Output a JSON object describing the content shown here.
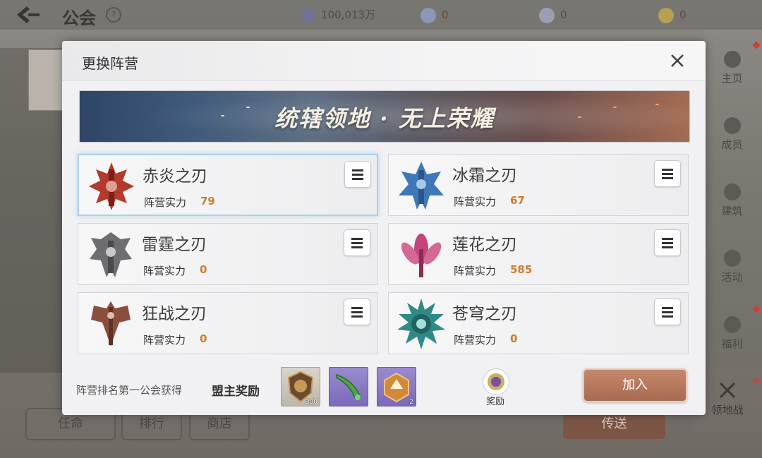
{
  "background": {
    "title": "公会",
    "help": "?",
    "resources": [
      {
        "icon": "power-icon",
        "value": "100,013万"
      },
      {
        "icon": "gem-icon",
        "value": "0"
      },
      {
        "icon": "shield-coin-icon",
        "value": "0"
      },
      {
        "icon": "gold-coin-icon",
        "value": "0"
      }
    ],
    "sidebar": [
      {
        "icon": "info-icon",
        "label": "主页"
      },
      {
        "icon": "members-icon",
        "label": "成员"
      },
      {
        "icon": "building-icon",
        "label": "建筑"
      },
      {
        "icon": "activity-icon",
        "label": "活动"
      },
      {
        "icon": "gift-icon",
        "label": "福利"
      }
    ],
    "bottom_buttons": [
      "任命",
      "排行",
      "商店"
    ],
    "transfer_label": "传送",
    "territory_war_label": "领地战"
  },
  "modal": {
    "title": "更换阵营",
    "banner_text": "统辖领地 · 无上荣耀",
    "power_label": "阵营实力",
    "camps": [
      {
        "name": "赤炎之刃",
        "power": "79",
        "color": "#b33a2e",
        "selected": true
      },
      {
        "name": "冰霜之刃",
        "power": "67",
        "color": "#3f78b8",
        "selected": false
      },
      {
        "name": "雷霆之刃",
        "power": "0",
        "color": "#6e6e72",
        "selected": false
      },
      {
        "name": "莲花之刃",
        "power": "585",
        "color": "#c2467a",
        "selected": false
      },
      {
        "name": "狂战之刃",
        "power": "0",
        "color": "#8a4f3c",
        "selected": false
      },
      {
        "name": "苍穹之刃",
        "power": "0",
        "color": "#2f8a86",
        "selected": false
      }
    ],
    "reward_label": "阵营排名第一公会获得",
    "reward_title": "盟主奖励",
    "reward_items": [
      {
        "icon": "territory-badge-icon",
        "count": "300"
      },
      {
        "icon": "green-horn-icon",
        "count": ""
      },
      {
        "icon": "rank-badge-icon",
        "count": "2"
      }
    ],
    "reward_button_label": "奖励",
    "join_label": "加入"
  }
}
